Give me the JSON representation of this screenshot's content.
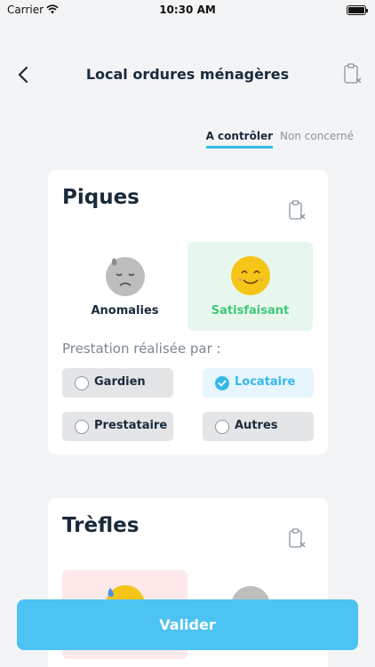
{
  "status_bar": {
    "carrier": "Carrier",
    "time": "10:30 AM"
  },
  "header": {
    "title": "Local ordures ménagères",
    "back_icon": "chevron-left-icon",
    "action_icon": "clipboard-x-icon"
  },
  "tabs": [
    {
      "label": "A contrôler",
      "active": true
    },
    {
      "label": "Non concerné",
      "active": false
    }
  ],
  "cards": [
    {
      "title": "Piques",
      "options": [
        {
          "label": "Anomalies",
          "icon": "sad-face-icon",
          "selected": false
        },
        {
          "label": "Satisfaisant",
          "icon": "happy-face-icon",
          "selected": true
        }
      ],
      "prestation_label": "Prestation réalisée par :",
      "prestataires": [
        {
          "label": "Gardien",
          "selected": false
        },
        {
          "label": "Locataire",
          "selected": true
        },
        {
          "label": "Prestataire",
          "selected": false
        },
        {
          "label": "Autres",
          "selected": false
        }
      ]
    },
    {
      "title": "Trèfles"
    }
  ],
  "footer": {
    "submit_label": "Valider"
  },
  "colors": {
    "accent": "#4cc3f2",
    "success": "#3fc878",
    "success_bg": "#e8f7ee",
    "danger_bg": "#fde9e9"
  }
}
